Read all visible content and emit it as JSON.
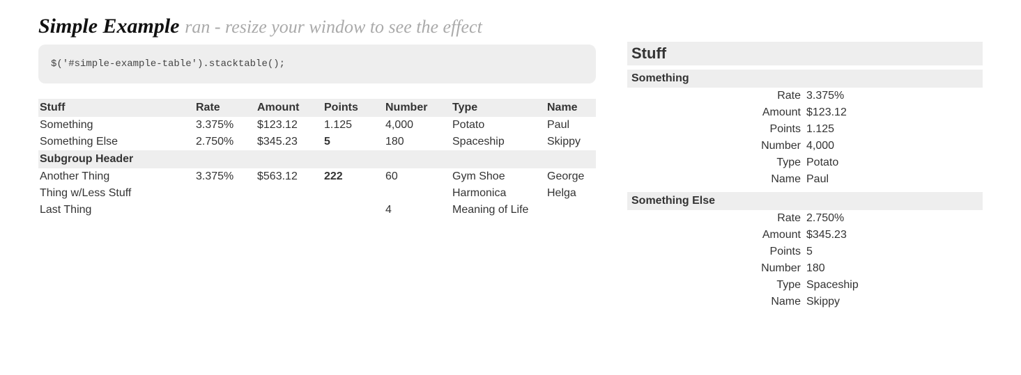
{
  "heading": {
    "title": "Simple Example",
    "subtitle": "ran - resize your window to see the effect"
  },
  "code": "$('#simple-example-table').stacktable();",
  "table": {
    "headers": [
      "Stuff",
      "Rate",
      "Amount",
      "Points",
      "Number",
      "Type",
      "Name"
    ],
    "rows": [
      {
        "cells": [
          "Something",
          "3.375%",
          "$123.12",
          "1.125",
          "4,000",
          "Potato",
          "Paul"
        ],
        "bold": [
          false,
          false,
          false,
          false,
          false,
          false,
          false
        ]
      },
      {
        "cells": [
          "Something Else",
          "2.750%",
          "$345.23",
          "5",
          "180",
          "Spaceship",
          "Skippy"
        ],
        "bold": [
          false,
          false,
          false,
          true,
          false,
          false,
          false
        ]
      }
    ],
    "subheader": "Subgroup Header",
    "rows2": [
      {
        "cells": [
          "Another Thing",
          "3.375%",
          "$563.12",
          "222",
          "60",
          "Gym Shoe",
          "George"
        ],
        "bold": [
          false,
          false,
          false,
          true,
          false,
          false,
          false
        ]
      },
      {
        "cells": [
          "Thing w/Less Stuff",
          "",
          "",
          "",
          "",
          "Harmonica",
          "Helga"
        ],
        "bold": [
          false,
          false,
          false,
          false,
          false,
          false,
          false
        ]
      },
      {
        "cells": [
          "Last Thing",
          "",
          "",
          "",
          "4",
          "Meaning of Life",
          ""
        ],
        "bold": [
          false,
          false,
          false,
          false,
          false,
          false,
          false
        ]
      }
    ]
  },
  "stack": {
    "big_header": "Stuff",
    "groups": [
      {
        "header": "Something",
        "pairs": [
          [
            "Rate",
            "3.375%"
          ],
          [
            "Amount",
            "$123.12"
          ],
          [
            "Points",
            "1.125"
          ],
          [
            "Number",
            "4,000"
          ],
          [
            "Type",
            "Potato"
          ],
          [
            "Name",
            "Paul"
          ]
        ]
      },
      {
        "header": "Something Else",
        "pairs": [
          [
            "Rate",
            "2.750%"
          ],
          [
            "Amount",
            "$345.23"
          ],
          [
            "Points",
            "5"
          ],
          [
            "Number",
            "180"
          ],
          [
            "Type",
            "Spaceship"
          ],
          [
            "Name",
            "Skippy"
          ]
        ]
      }
    ]
  }
}
